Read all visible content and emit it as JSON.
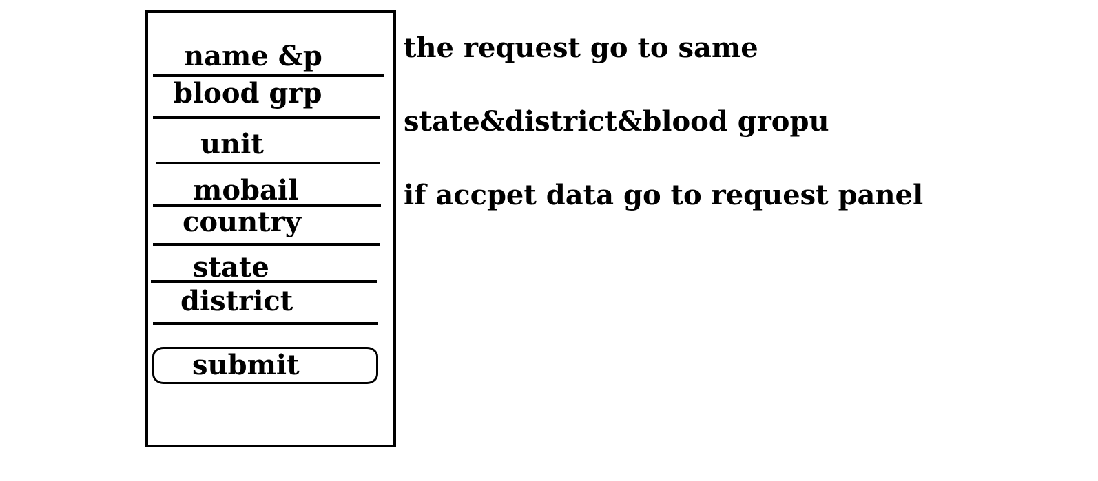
{
  "form": {
    "fields": [
      {
        "label": "name &p"
      },
      {
        "label": "blood grp"
      },
      {
        "label": "unit"
      },
      {
        "label": "mobail"
      },
      {
        "label": "country"
      },
      {
        "label": "state"
      },
      {
        "label": "district"
      }
    ],
    "submit_label": "submit"
  },
  "notes": [
    "the request go to same",
    "state&district&blood gropu",
    "if accpet data go to request  panel"
  ]
}
